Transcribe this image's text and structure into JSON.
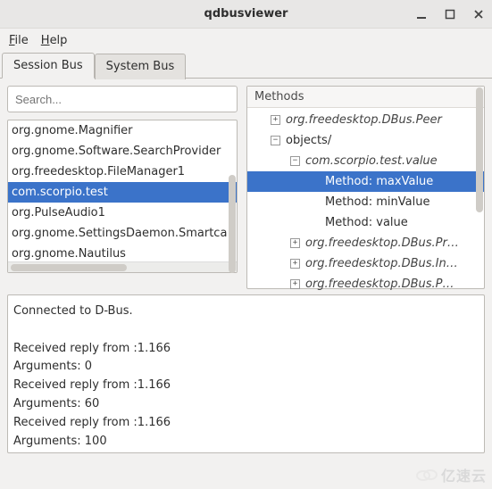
{
  "window": {
    "title": "qdbusviewer"
  },
  "menu": {
    "file_letter": "F",
    "file_rest": "ile",
    "help_letter": "H",
    "help_rest": "elp"
  },
  "tabs": {
    "session": "Session Bus",
    "system": "System Bus"
  },
  "search": {
    "placeholder": "Search..."
  },
  "services": [
    "org.gnome.Magnifier",
    "org.gnome.Software.SearchProvider",
    "org.freedesktop.FileManager1",
    "com.scorpio.test",
    "org.PulseAudio1",
    "org.gnome.SettingsDaemon.Smartca",
    "org.gnome.Nautilus"
  ],
  "services_selected_index": 3,
  "tree": {
    "header": "Methods",
    "rows": [
      {
        "indent": 1,
        "expander": "+",
        "label": "org.freedesktop.DBus.Peer",
        "italic": true
      },
      {
        "indent": 1,
        "expander": "-",
        "label": "objects/",
        "italic": false
      },
      {
        "indent": 2,
        "expander": "-",
        "label": "com.scorpio.test.value",
        "italic": true
      },
      {
        "indent": 3,
        "expander": "",
        "label": "Method: maxValue",
        "italic": false,
        "selected": true
      },
      {
        "indent": 3,
        "expander": "",
        "label": "Method: minValue",
        "italic": false
      },
      {
        "indent": 3,
        "expander": "",
        "label": "Method: value",
        "italic": false
      },
      {
        "indent": 2,
        "expander": "+",
        "label": "org.freedesktop.DBus.Pr…",
        "italic": true
      },
      {
        "indent": 2,
        "expander": "+",
        "label": "org.freedesktop.DBus.In…",
        "italic": true
      },
      {
        "indent": 2,
        "expander": "+",
        "label": "org.freedesktop.DBus.P…",
        "italic": true
      }
    ]
  },
  "console": {
    "lines": [
      "Connected to D-Bus.",
      "",
      "Received reply from :1.166",
      "  Arguments: 0",
      "Received reply from :1.166",
      "  Arguments: 60",
      "Received reply from :1.166",
      "  Arguments: 100"
    ]
  },
  "watermark": "亿速云"
}
